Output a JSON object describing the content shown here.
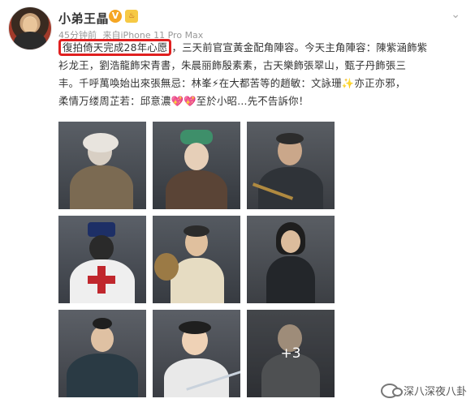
{
  "header": {
    "username": "小弟王晶",
    "vip_label": "V",
    "badge_label": "♨",
    "more": "⌄",
    "time": "45分钟前",
    "source": "来自iPhone 11 Pro Max"
  },
  "post": {
    "highlight": "復拍倚天完成28年心愿",
    "line1_rest": "，三天前官宣黃金配角陣容。今天主角陣容：陳紫涵飾紫",
    "line2": "衫龙王，劉浩龍飾宋青書，朱晨丽飾殷素素，古天樂飾張翠山，甄子丹飾張三",
    "line3": "丰。千呼萬喚始出來張無忌：林峯⚡在大都苦等的趙敏：文詠珊✨亦正亦邪，",
    "line4_a": "柔情万缕周芷若：邱意濃",
    "line4_emoji": "💖💖",
    "line4_b": "至於小昭…先不告訴你！"
  },
  "gallery": {
    "more_count": "+3"
  },
  "watermark": {
    "text": "深八深夜八卦"
  },
  "colors": {
    "highlight_border": "#e02020",
    "vip": "#f5a623"
  }
}
